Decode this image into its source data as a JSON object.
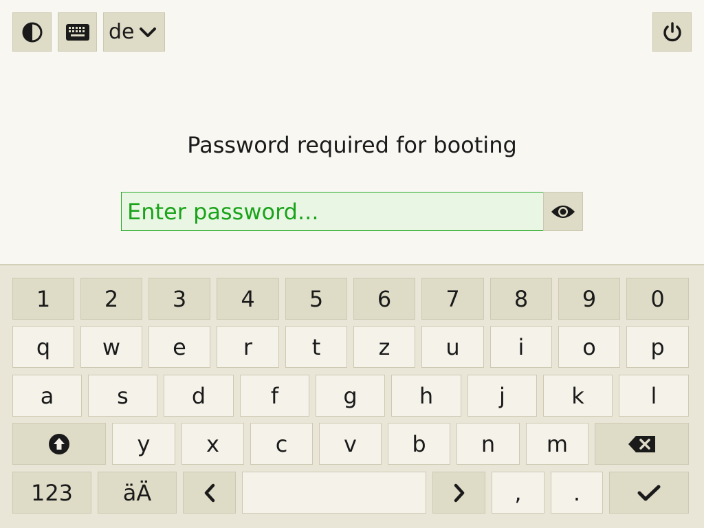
{
  "topbar": {
    "contrast_icon": "contrast-icon",
    "keyboard_icon": "keyboard-icon",
    "layout_label": "de",
    "layout_chevron_icon": "chevron-down-icon",
    "power_icon": "power-icon"
  },
  "prompt": {
    "title": "Password required for booting",
    "placeholder": "Enter password...",
    "value": "",
    "reveal_icon": "eye-icon"
  },
  "keyboard": {
    "row_numbers": [
      "1",
      "2",
      "3",
      "4",
      "5",
      "6",
      "7",
      "8",
      "9",
      "0"
    ],
    "row_top": [
      "q",
      "w",
      "e",
      "r",
      "t",
      "z",
      "u",
      "i",
      "o",
      "p"
    ],
    "row_home": [
      "a",
      "s",
      "d",
      "f",
      "g",
      "h",
      "j",
      "k",
      "l"
    ],
    "row_bottom": [
      "y",
      "x",
      "c",
      "v",
      "b",
      "n",
      "m"
    ],
    "shift_icon": "shift-up-icon",
    "backspace_icon": "backspace-icon",
    "numbers_label": "123",
    "umlaut_label": "äÄ",
    "left_icon": "chevron-left-icon",
    "space_label": "",
    "right_icon": "chevron-right-icon",
    "comma_label": ",",
    "period_label": ".",
    "enter_icon": "checkmark-icon"
  },
  "colors": {
    "background": "#f8f7f2",
    "button": "#dedbc6",
    "key": "#f4f2e9",
    "input_fill": "#e9f6e4",
    "input_border": "#22aa22",
    "input_text": "#1aa31a"
  }
}
